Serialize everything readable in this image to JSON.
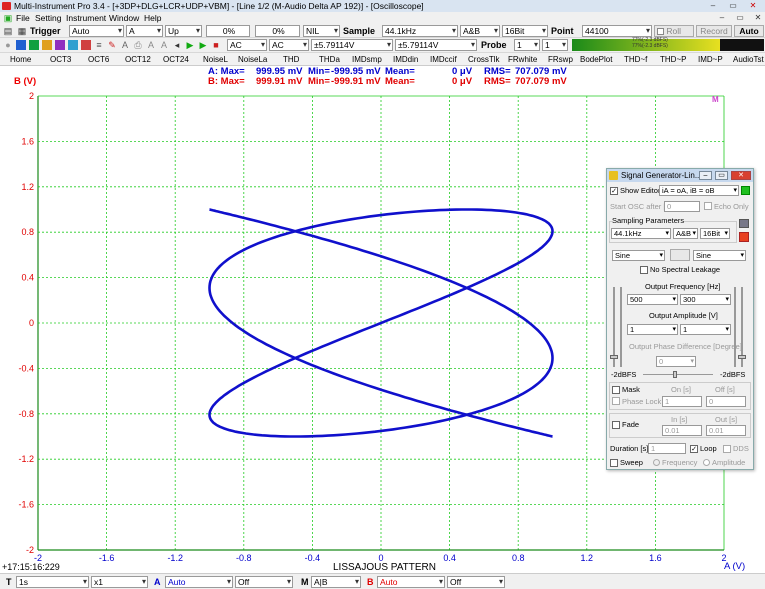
{
  "titlebar": {
    "title": "Multi-Instrument Pro 3.4  -  [+3DP+DLG+LCR+UDP+VBM]  -  [Line 1/2 (M-Audio Delta AP 192)] - [Oscilloscope]",
    "min": "–",
    "restore": "▭",
    "close": "✕"
  },
  "menu": [
    "File",
    "Setting",
    "Instrument",
    "Window",
    "Help"
  ],
  "toolbar1": {
    "trigger_label": "Trigger",
    "trigger_mode": "Auto",
    "trigger_channel": "A",
    "trigger_edge": "Up",
    "trigger_level": "0%",
    "trigger_delay": "0%",
    "nil_value": "NIL",
    "sample_label": "Sample",
    "sample_rate": "44.1kHz",
    "channels": "A&B",
    "bits": "16Bit",
    "point_label": "Point",
    "point_value": "44100",
    "roll_label": "Roll",
    "record_label": "Record",
    "auto_label": "Auto",
    "window_min": "–",
    "window_restore": "▭",
    "window_close": "✕"
  },
  "toolbar2": {
    "coupling_a": "AC",
    "coupling_b": "AC",
    "range_a": "±5.79114V",
    "range_b": "±5.79114V",
    "probe_label": "Probe",
    "probe_a": "1",
    "probe_b": "1",
    "meter_a": "77%(-2.3 dBFS)",
    "meter_b": "77%(-2.3 dBFS)"
  },
  "tabs": [
    "Home",
    "OCT3",
    "OCT6",
    "OCT12",
    "OCT24",
    "NoiseL",
    "NoiseLa",
    "THD",
    "THDa",
    "IMDsmp",
    "IMDdin",
    "IMDccif",
    "CrossTlk",
    "FRwhite",
    "FRswp",
    "BodePlot",
    "THD~f",
    "THD~P",
    "IMD~P",
    "AudioTst"
  ],
  "stats": {
    "a": {
      "label": "A: Max=",
      "max": "999.95 mV",
      "min_label": "Min=",
      "min": "-999.95 mV",
      "mean_label": "Mean=",
      "mean": "0  μV",
      "rms_label": "RMS=",
      "rms": "707.079 mV"
    },
    "b": {
      "label": "B: Max=",
      "max": "999.91 mV",
      "min_label": "Min=",
      "min": "-999.91 mV",
      "mean_label": "Mean=",
      "mean": "0  μV",
      "rms_label": "RMS=",
      "rms": "707.079 mV"
    }
  },
  "plot": {
    "y_axis_label": "B (V)",
    "x_axis_label": "A (V)",
    "caption": "LISSAJOUS PATTERN",
    "timestamp": "+17:15:16:229",
    "corner_mark": "M"
  },
  "chart_data": {
    "type": "line",
    "xlabel": "A (V)",
    "ylabel": "B (V)",
    "xlim": [
      -2,
      2
    ],
    "ylim": [
      -2,
      2
    ],
    "x_ticks": [
      "-2",
      "-1.6",
      "-1.2",
      "-0.8",
      "-0.4",
      "0",
      "0.4",
      "0.8",
      "1.2",
      "1.6",
      "2"
    ],
    "y_ticks": [
      "2",
      "1.6",
      "1.2",
      "0.8",
      "0.4",
      "0",
      "-0.4",
      "-0.8",
      "-1.2",
      "-1.6",
      "-2"
    ],
    "grid": true,
    "series": [
      {
        "curve": "lissajous",
        "x_amplitude": 1,
        "y_amplitude": 1,
        "x_frequency": 500,
        "y_frequency": 300,
        "color": "#1010cc"
      }
    ]
  },
  "siggen": {
    "title": "Signal Generator-Lin...",
    "show_editor_label": "Show Editor",
    "show_editor_checked": "✓",
    "editor_formula": "iA = oA, iB = oB",
    "start_osc_label": "Start OSC after [s]",
    "start_osc_value": "0",
    "echo_only": "Echo Only",
    "sampling_label": "Sampling Parameters",
    "rate": "44.1kHz",
    "channels": "A&B",
    "bits": "16Bit",
    "wave_a": "Sine",
    "wave_b": "Sine",
    "no_spectral_leakage": "No Spectral Leakage",
    "output_freq_label": "Output Frequency [Hz]",
    "freq_a": "500",
    "freq_b": "300",
    "output_amp_label": "Output Amplitude [V]",
    "amp_a": "1",
    "amp_b": "1",
    "phase_label": "Output Phase Difference [Degree]",
    "phase_value": "0",
    "dbfs_a": "-2dBFS",
    "dbfs_b": "-2dBFS",
    "mask_label": "Mask",
    "on_label": "On [s]",
    "off_label": "Off [s]",
    "phase_lock": "Phase Lock",
    "mask_on": "1",
    "mask_off": "0",
    "fade_label": "Fade",
    "in_label": "In [s]",
    "out_label": "Out [s]",
    "fade_in": "0.01",
    "fade_out": "0.01",
    "duration_label": "Duration [s]",
    "duration_value": "1",
    "loop_label": "Loop",
    "loop_checked": "✓",
    "dds_label": "DDS",
    "sweep_label": "Sweep",
    "frequency_radio": "Frequency",
    "amplitude_radio": "Amplitude",
    "win_min": "–",
    "win_max": "▭",
    "win_close": "✕"
  },
  "statusbar": {
    "t_label": "T",
    "timebase": "1s",
    "zoom": "x1",
    "a_label": "A",
    "a_mode": "Auto",
    "a_off": "Off",
    "m_label": "M",
    "m_mode": "A|B",
    "b_label": "B",
    "b_mode": "Auto",
    "b_off": "Off"
  },
  "colors": {
    "trace": "#1010cc",
    "grid": "#22cc22",
    "channel_a": "#0000cc",
    "channel_b": "#e00000"
  }
}
